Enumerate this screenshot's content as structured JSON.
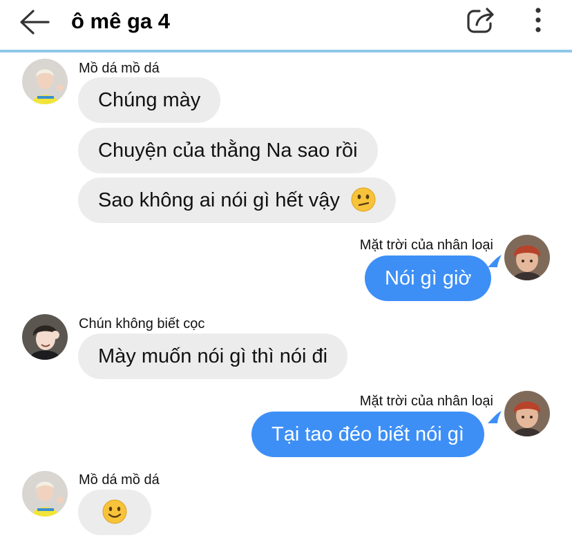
{
  "header": {
    "title": "ô mê ga 4",
    "back_icon": "arrow-left-icon",
    "share_icon": "share-icon",
    "more_icon": "more-vertical-icon",
    "rule_color": "#8ec6ea"
  },
  "colors": {
    "incoming_bubble": "#ececec",
    "outgoing_bubble": "#3d8ff6"
  },
  "messages": [
    {
      "sender": "Mồ dá mồ dá",
      "direction": "incoming",
      "bubbles": [
        "Chúng mày",
        "Chuyện của thằng Na sao rồi",
        "Sao không ai nói gì hết vậy"
      ],
      "last_bubble_emoji": "confused-face-emoji"
    },
    {
      "sender": "Mặt trời của nhân loại",
      "direction": "outgoing",
      "bubbles": [
        "Nói gì giờ"
      ]
    },
    {
      "sender": "Chún không biết cọc",
      "direction": "incoming",
      "bubbles": [
        "Mày muốn nói gì thì nói đi"
      ]
    },
    {
      "sender": "Mặt trời của nhân loại",
      "direction": "outgoing",
      "bubbles": [
        "Tại tao đéo biết nói gì"
      ]
    },
    {
      "sender": "Mồ dá mồ dá",
      "direction": "incoming",
      "bubbles": [],
      "emoji_bubble": "slightly-smiling-face-emoji"
    }
  ]
}
